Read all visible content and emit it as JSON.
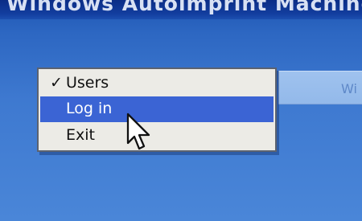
{
  "window": {
    "title": "Windows Autoimprint Machine C"
  },
  "background_panel": {
    "label": "Wi"
  },
  "context_menu": {
    "items": [
      {
        "label": "Users",
        "checked": true,
        "highlighted": false
      },
      {
        "label": "Log in",
        "checked": false,
        "highlighted": true
      },
      {
        "label": "Exit",
        "checked": false,
        "highlighted": false
      }
    ],
    "check_glyph": "✓"
  },
  "colors": {
    "desktop_blue": "#3f7ad0",
    "menu_background": "#ecebe6",
    "highlight": "#3b64d4"
  },
  "icons": {
    "check": "check-icon",
    "pointer": "mouse-pointer-icon"
  }
}
